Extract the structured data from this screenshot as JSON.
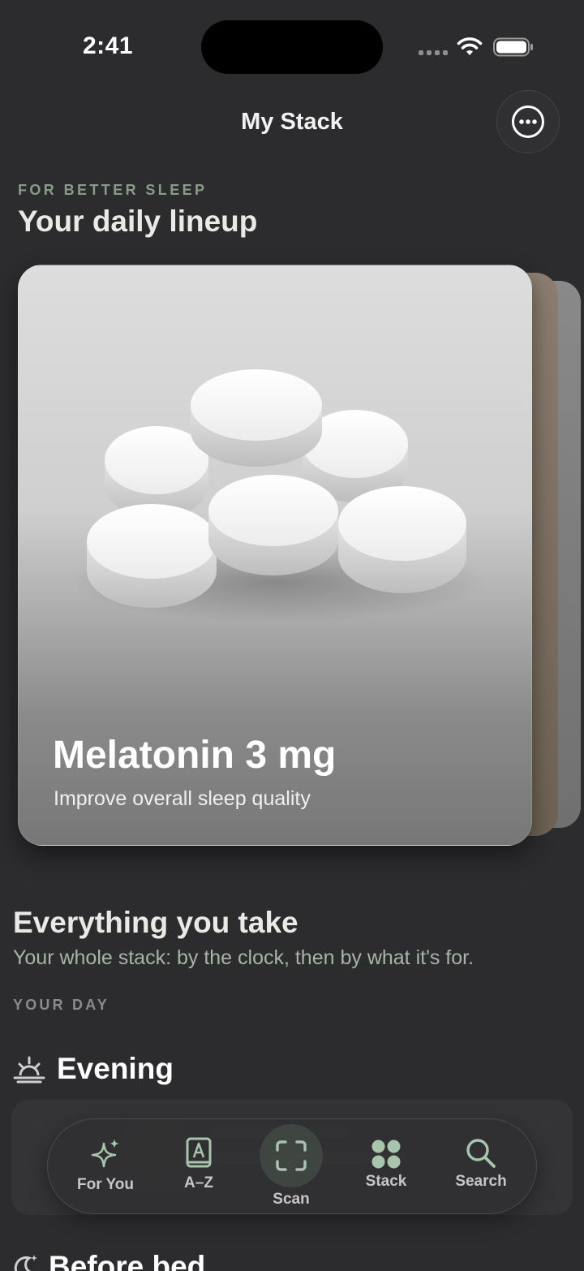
{
  "status_bar": {
    "time": "2:41"
  },
  "header": {
    "title": "My Stack"
  },
  "lineup": {
    "eyebrow": "FOR BETTER SLEEP",
    "title": "Your daily lineup",
    "card": {
      "name": "Melatonin 3 mg",
      "subtitle": "Improve overall sleep quality"
    }
  },
  "everything": {
    "title": "Everything you take",
    "subtitle": "Your whole stack: by the clock, then by what it's for.",
    "day_label": "YOUR DAY"
  },
  "sections": {
    "evening": "Evening",
    "before_bed": "Before bed"
  },
  "tab_bar": {
    "items": [
      {
        "label": "For You",
        "icon": "sparkles-icon"
      },
      {
        "label": "A–Z",
        "icon": "book-a-icon"
      },
      {
        "label": "Scan",
        "icon": "scan-icon"
      },
      {
        "label": "Stack",
        "icon": "grid-dots-icon"
      },
      {
        "label": "Search",
        "icon": "search-icon"
      }
    ]
  },
  "colors": {
    "background": "#2c2c2e",
    "accent_green": "#a8c4ac",
    "eyebrow": "#8a9a8a"
  }
}
